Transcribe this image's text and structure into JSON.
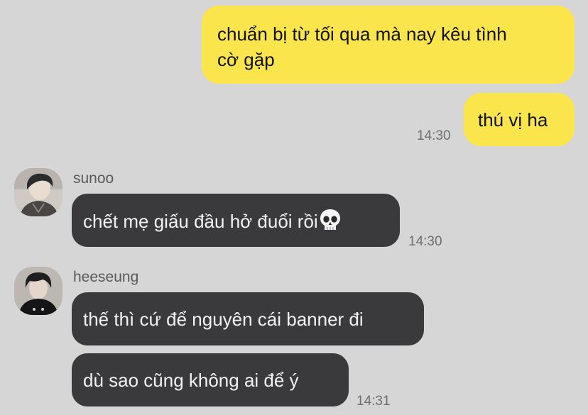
{
  "conversation": {
    "messages": [
      {
        "direction": "out",
        "text": "chuẩn bị từ tối qua mà nay kêu tình cờ gặp",
        "line1": "chuẩn bị từ tối qua mà nay kêu tình",
        "line2": "cờ gặp"
      },
      {
        "direction": "out",
        "text": "thú vị ha",
        "time": "14:30"
      },
      {
        "direction": "in",
        "sender": "sunoo",
        "text": "chết mẹ giấu đầu hở đuổi rồi",
        "emoji": "💀",
        "emoji_name": "skull-emoji",
        "time": "14:30"
      },
      {
        "direction": "in",
        "sender": "heeseung",
        "text": "thế thì cứ để nguyên cái banner đi"
      },
      {
        "direction": "in",
        "sender": "heeseung",
        "text": "dù sao cũng không ai để ý",
        "time": "14:31"
      }
    ]
  },
  "colors": {
    "background": "#d6d6d6",
    "outgoing_bubble": "#fae54c",
    "incoming_bubble": "#3a3a3c",
    "timestamp": "#6e6e6e"
  }
}
